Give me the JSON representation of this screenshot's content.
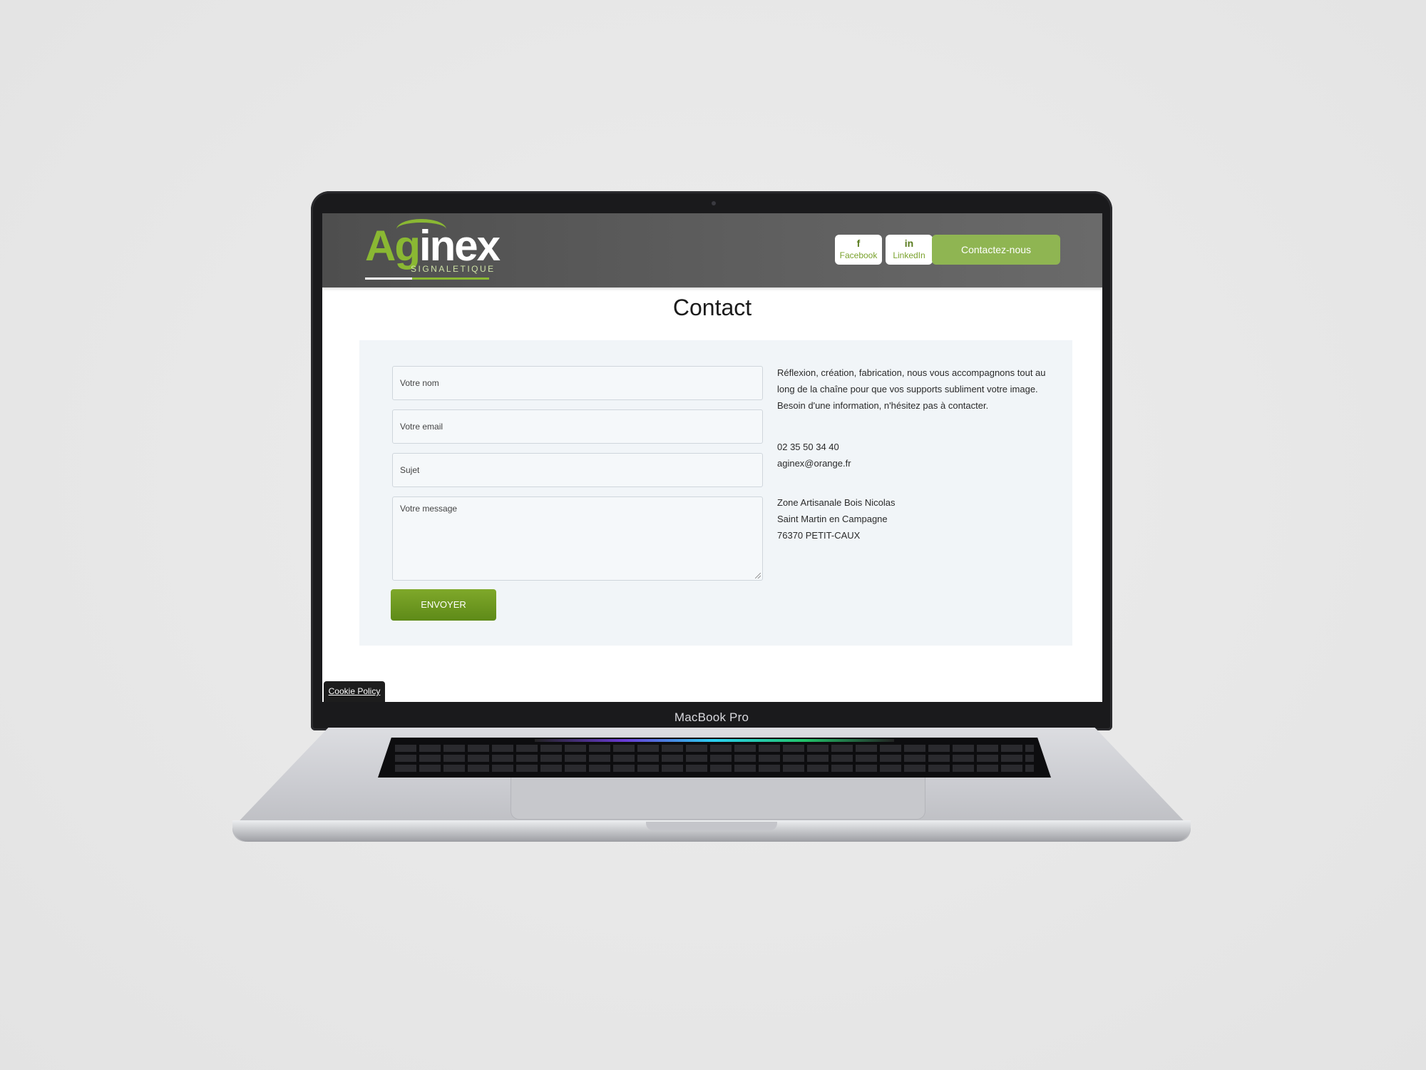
{
  "device": {
    "label": "MacBook Pro"
  },
  "header": {
    "logo": {
      "word_a": "Ag",
      "word_b": "inex",
      "sub": "SIGNALETIQUE"
    },
    "social": [
      {
        "icon": "facebook-icon",
        "glyph": "f",
        "label": "Facebook"
      },
      {
        "icon": "linkedin-icon",
        "glyph": "in",
        "label": "LinkedIn"
      }
    ],
    "cta_label": "Contactez-nous"
  },
  "page": {
    "title": "Contact"
  },
  "form": {
    "name_placeholder": "Votre nom",
    "email_placeholder": "Votre email",
    "subject_placeholder": "Sujet",
    "message_placeholder": "Votre message",
    "submit_label": "ENVOYER"
  },
  "info": {
    "intro": "Réflexion, création, fabrication, nous vous accompagnons tout au long de la chaîne pour que vos supports subliment votre image. Besoin d'une information, n'hésitez pas à contacter.",
    "phone": "02 35 50 34 40",
    "email": "aginex@orange.fr",
    "address": [
      "Zone Artisanale Bois Nicolas",
      "Saint Martin en Campagne",
      "76370 PETIT-CAUX"
    ]
  },
  "cookie_label": "Cookie Policy",
  "colors": {
    "brand_green": "#8ab833",
    "button_green": "#6a9620",
    "header_gray": "#5a5a5a"
  }
}
